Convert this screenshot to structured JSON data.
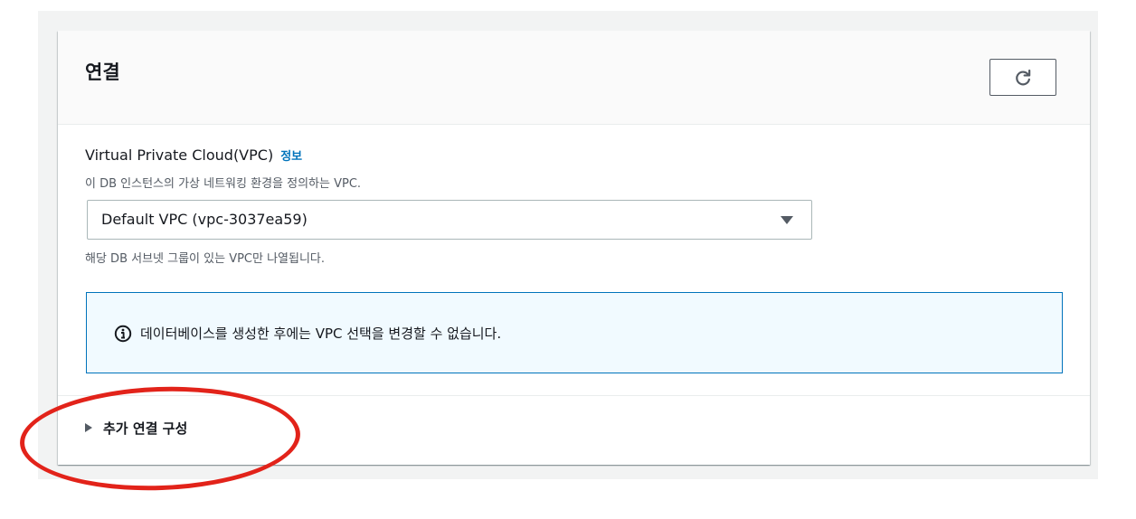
{
  "panel": {
    "title": "연결",
    "refresh_icon": "refresh-icon"
  },
  "vpc_field": {
    "label": "Virtual Private Cloud(VPC)",
    "info_link": "정보",
    "description": "이 DB 인스턴스의 가상 네트워킹 환경을 정의하는 VPC.",
    "selected_value": "Default VPC (vpc-3037ea59)",
    "constraint": "해당 DB 서브넷 그룹이 있는 VPC만 나열됩니다."
  },
  "alert": {
    "icon": "info-icon",
    "text": "데이터베이스를 생성한 후에는 VPC 선택을 변경할 수 없습니다.",
    "border_color": "#0073bb",
    "background_color": "#f1faff"
  },
  "expander": {
    "label": "추가 연결 구성",
    "state": "collapsed"
  },
  "annotation": {
    "color": "#e2231a"
  }
}
